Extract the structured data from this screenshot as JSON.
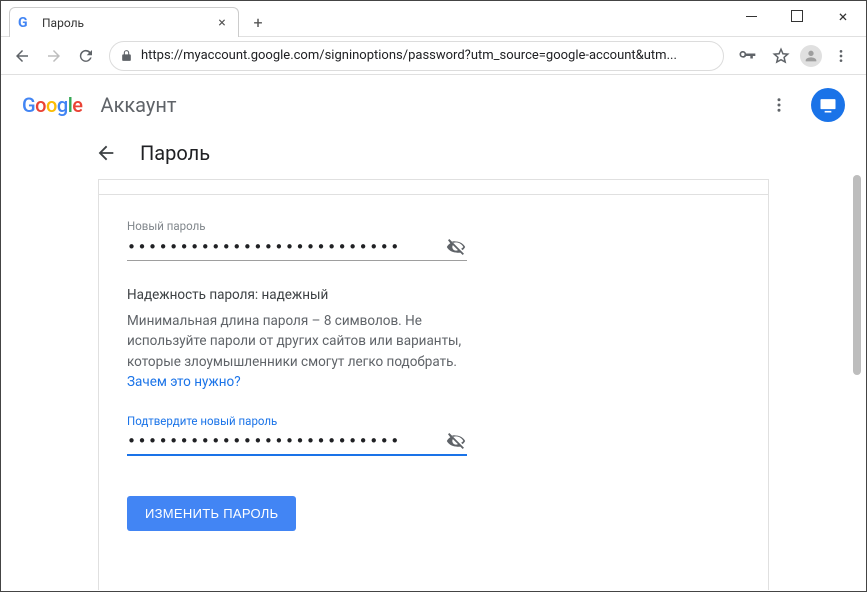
{
  "window": {
    "tab_title": "Пароль"
  },
  "toolbar": {
    "url_display": "https://myaccount.google.com/signinoptions/password?utm_source=google-account&utm..."
  },
  "header": {
    "logo_letters": [
      "G",
      "o",
      "o",
      "g",
      "l",
      "e"
    ],
    "account_label": "Аккаунт"
  },
  "page": {
    "title": "Пароль"
  },
  "form": {
    "new_password_label": "Новый пароль",
    "new_password_value": "••••••••••••••••••••••••••",
    "strength_label": "Надежность пароля:",
    "strength_value": "надежный",
    "hint_text": "Минимальная длина пароля – 8 символов. Не используйте пароли от других сайтов или варианты, которые злоумышленники смогут легко подобрать.",
    "hint_link": "Зачем это нужно?",
    "confirm_label": "Подтвердите новый пароль",
    "confirm_value": "••••••••••••••••••••••••••",
    "submit_label": "ИЗМЕНИТЬ ПАРОЛЬ"
  }
}
